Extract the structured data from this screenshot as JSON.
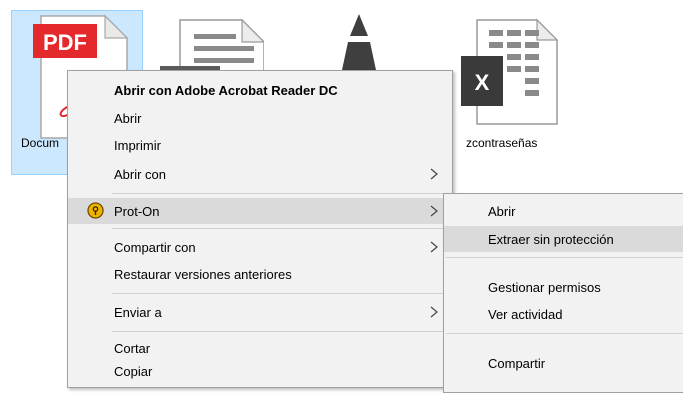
{
  "desktop": {
    "files": [
      {
        "label": "Docum",
        "type": "pdf",
        "badge": "PDF"
      },
      {
        "label": "",
        "type": "document"
      },
      {
        "label": "",
        "type": "vlc"
      },
      {
        "label": "zcontraseñas",
        "type": "excel",
        "badge": "X"
      }
    ]
  },
  "context_menu": {
    "items": [
      {
        "label": "Abrir con Adobe Acrobat Reader DC",
        "bold": true
      },
      {
        "label": "Abrir"
      },
      {
        "label": "Imprimir"
      },
      {
        "label": "Abrir con",
        "submenu": true
      },
      {
        "label": "Prot-On",
        "submenu": true,
        "icon": "prot-on-icon",
        "highlighted": true
      },
      {
        "label": "Compartir con",
        "submenu": true
      },
      {
        "label": "Restaurar versiones anteriores"
      },
      {
        "label": "Enviar a",
        "submenu": true
      },
      {
        "label": "Cortar"
      },
      {
        "label": "Copiar"
      }
    ]
  },
  "submenu": {
    "items": [
      {
        "label": "Abrir"
      },
      {
        "label": "Extraer sin protección",
        "highlighted": true
      },
      {
        "label": "Gestionar permisos"
      },
      {
        "label": "Ver actividad"
      },
      {
        "label": "Compartir"
      }
    ]
  },
  "colors": {
    "selection_bg": "#cce8ff",
    "pdf_red": "#e3292c",
    "excel_dark": "#3a3a3a",
    "menu_bg": "#f2f2f2",
    "menu_hover": "#dadada",
    "prot_on": "#f0b400"
  }
}
